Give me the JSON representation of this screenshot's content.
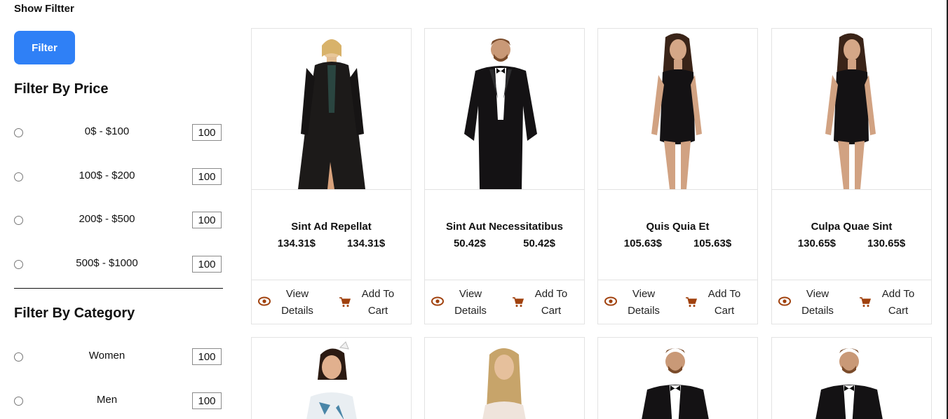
{
  "sidebar": {
    "show_filter_label": "Show Filtter",
    "filter_button_label": "Filter",
    "price_title": "Filter By Price",
    "price_options": [
      {
        "label": "0$ - $100",
        "count": "100"
      },
      {
        "label": "100$ - $200",
        "count": "100"
      },
      {
        "label": "200$ - $500",
        "count": "100"
      },
      {
        "label": "500$ - $1000",
        "count": "100"
      }
    ],
    "category_title": "Filter By Category",
    "category_options": [
      {
        "label": "Women",
        "count": "100"
      },
      {
        "label": "Men",
        "count": "100"
      }
    ]
  },
  "products": [
    {
      "name": "Sint Ad Repellat",
      "price": "134.31$",
      "price2": "134.31$",
      "image": "woman-black-coat"
    },
    {
      "name": "Sint Aut Necessitatibus",
      "price": "50.42$",
      "price2": "50.42$",
      "image": "man-tuxedo"
    },
    {
      "name": "Quis Quia Et",
      "price": "105.63$",
      "price2": "105.63$",
      "image": "woman-black-dress"
    },
    {
      "name": "Culpa Quae Sint",
      "price": "130.65$",
      "price2": "130.65$",
      "image": "woman-black-dress"
    }
  ],
  "products_row2": [
    {
      "image": "girl-white-dress"
    },
    {
      "image": "woman-blonde"
    },
    {
      "image": "man-tuxedo"
    },
    {
      "image": "man-tuxedo"
    }
  ],
  "actions": {
    "view_line1": "View",
    "view_line2": "Details",
    "cart_line1": "Add To",
    "cart_line2": "Cart",
    "view_icon": "eye-icon",
    "cart_icon": "cart-icon",
    "icon_color": "#a0410d"
  },
  "colors": {
    "accent": "#2f80f6"
  }
}
